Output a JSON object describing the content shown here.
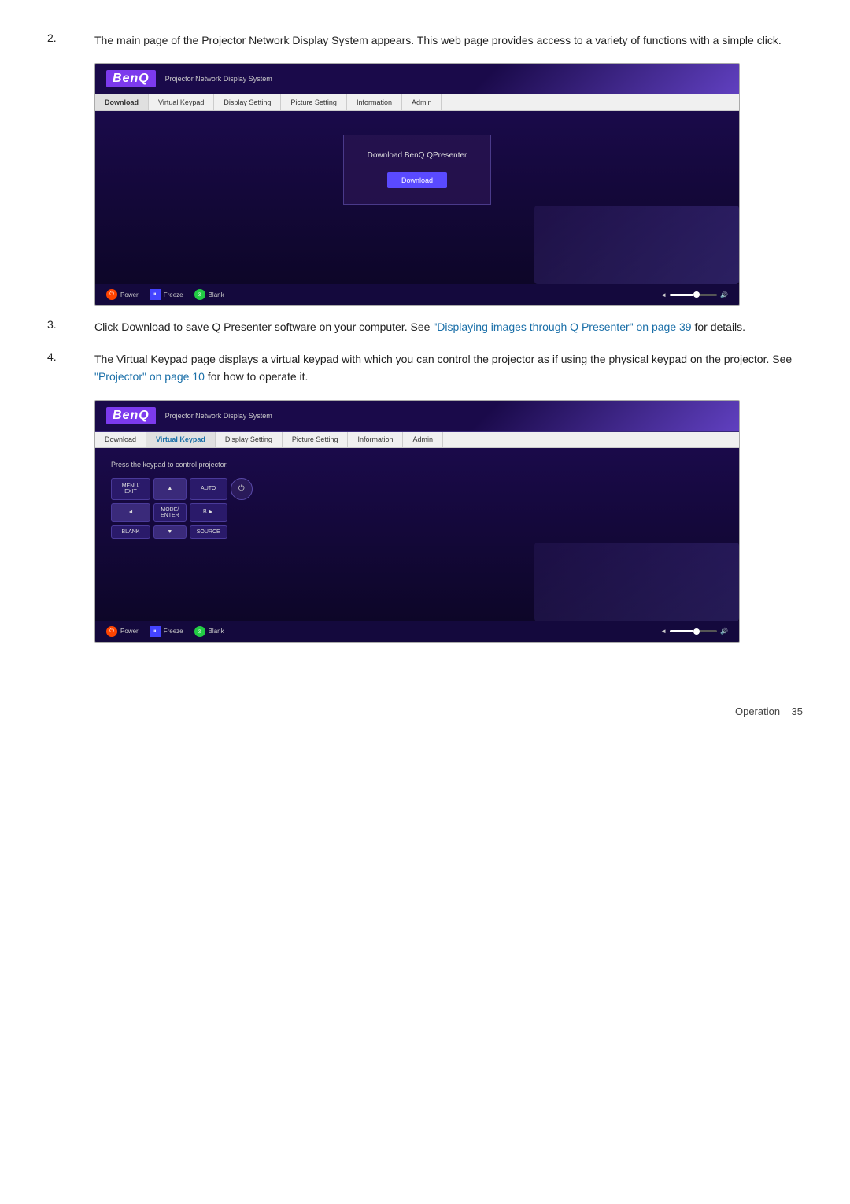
{
  "steps": [
    {
      "num": "2.",
      "text": "The main page of the Projector Network Display System appears. This web page provides access to a variety of functions with a simple click."
    },
    {
      "num": "3.",
      "text_before": "Click Download to save Q Presenter software on your computer. See ",
      "link_text": "\"Displaying images through Q Presenter\" on page 39",
      "text_after": " for details."
    },
    {
      "num": "4.",
      "text": "The Virtual Keypad page displays a virtual keypad with which you can control the projector as if using the physical keypad on the projector. See ",
      "link_text": "\"Projector\" on page 10",
      "text_after": " for how to operate it."
    }
  ],
  "ui1": {
    "logo": "BenQ",
    "subtitle": "Projector Network Display System",
    "nav": [
      "Download",
      "Virtual Keypad",
      "Display Setting",
      "Picture Setting",
      "Information",
      "Admin"
    ],
    "active_nav": "Download",
    "download_card_title": "Download BenQ QPresenter",
    "download_btn_label": "Download",
    "footer": {
      "power_label": "Power",
      "freeze_label": "Freeze",
      "blank_label": "Blank"
    }
  },
  "ui2": {
    "logo": "BenQ",
    "subtitle": "Projector Network Display System",
    "nav": [
      "Download",
      "Virtual Keypad",
      "Display Setting",
      "Picture Setting",
      "Information",
      "Admin"
    ],
    "active_nav": "Virtual Keypad",
    "keypad_label": "Press the keypad to control projector.",
    "keypad_buttons": [
      [
        "MENU/EXIT",
        "▲",
        "AUTO",
        "⏻"
      ],
      [
        "◄ ►",
        "MODE/ENTER",
        "B ►",
        ""
      ],
      [
        "BLANK",
        "▼",
        "SOURCE",
        ""
      ]
    ],
    "footer": {
      "power_label": "Power",
      "freeze_label": "Freeze",
      "blank_label": "Blank"
    }
  },
  "page_footer": {
    "text": "Operation",
    "page_num": "35"
  }
}
